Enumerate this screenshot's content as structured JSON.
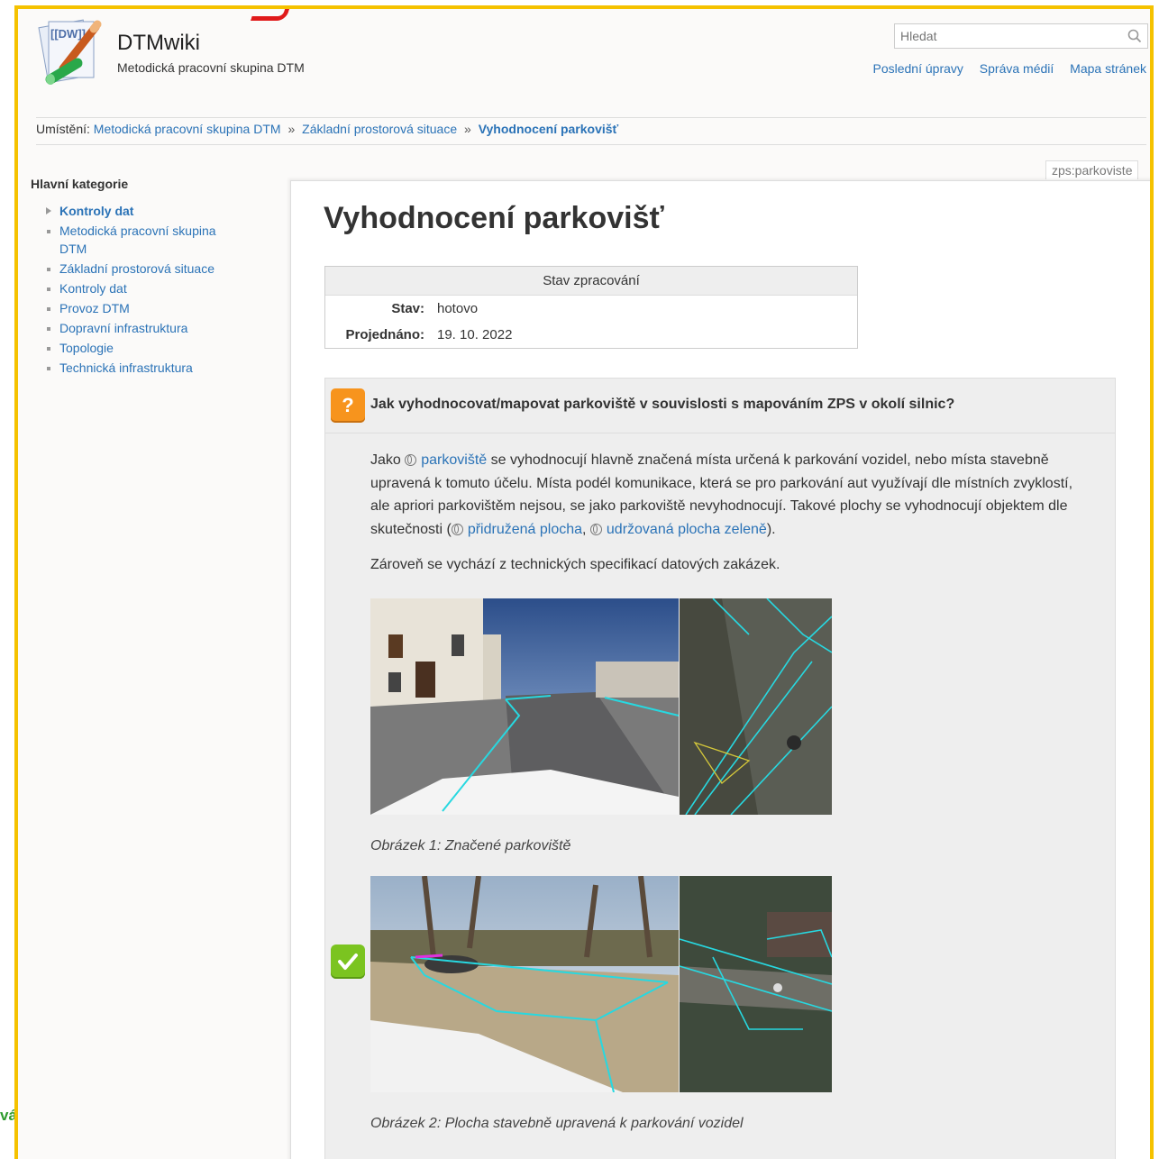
{
  "site": {
    "title": "DTMwiki",
    "subtitle": "Metodická pracovní skupina DTM",
    "logo_text": "[[DW]]"
  },
  "search": {
    "placeholder": "Hledat"
  },
  "tools": [
    "Poslední úpravy",
    "Správa médií",
    "Mapa stránek"
  ],
  "breadcrumb": {
    "label": "Umístění:",
    "items": [
      "Metodická pracovní skupina DTM",
      "Základní prostorová situace",
      "Vyhodnocení parkovišť"
    ],
    "sep": "»"
  },
  "sidebar": {
    "heading": "Hlavní kategorie",
    "items": [
      {
        "label": "Kontroly dat",
        "active": true
      },
      {
        "label": "Metodická pracovní skupina DTM"
      },
      {
        "label": "Základní prostorová situace"
      },
      {
        "label": "Kontroly dat"
      },
      {
        "label": "Provoz DTM"
      },
      {
        "label": "Dopravní infrastruktura"
      },
      {
        "label": "Topologie"
      },
      {
        "label": "Technická infrastruktura"
      }
    ]
  },
  "page": {
    "id": "zps:parkoviste",
    "title": "Vyhodnocení parkovišť",
    "status_table": {
      "header": "Stav zpracování",
      "rows": [
        {
          "key": "Stav:",
          "value": "hotovo"
        },
        {
          "key": "Projednáno:",
          "value": "19. 10. 2022"
        }
      ]
    },
    "faq": {
      "question": "Jak vyhodnocovat/mapovat parkoviště v souvislosti s mapováním ZPS v okolí silnic?",
      "p1": {
        "t1": "Jako ",
        "link1": "parkoviště",
        "t2": " se vyhodnocují hlavně značená místa určená k parkování vozidel, nebo místa stavebně upravená k tomuto účelu. Místa podél komunikace, která se pro parkování aut využívají dle místních zvyklostí, ale apriori parkovištěm nejsou, se jako parkoviště nevyhodnocují. Takové plochy se vyhodnocují objektem dle skutečnosti (",
        "link2": "přidružená plocha",
        "t3": ", ",
        "link3": "udržovaná plocha zeleně",
        "t4": ")."
      },
      "p2": "Zároveň se vychází z technických specifikací datových zakázek.",
      "captions": [
        "Obrázek 1: Značené parkoviště",
        "Obrázek 2: Plocha stavebně upravená k parkování vozidel"
      ]
    }
  },
  "corner_text": "vá",
  "colors": {
    "accent": "#f5c200",
    "link": "#2b73b7",
    "question_icon": "#f7941d",
    "ok_icon": "#7bc420"
  }
}
